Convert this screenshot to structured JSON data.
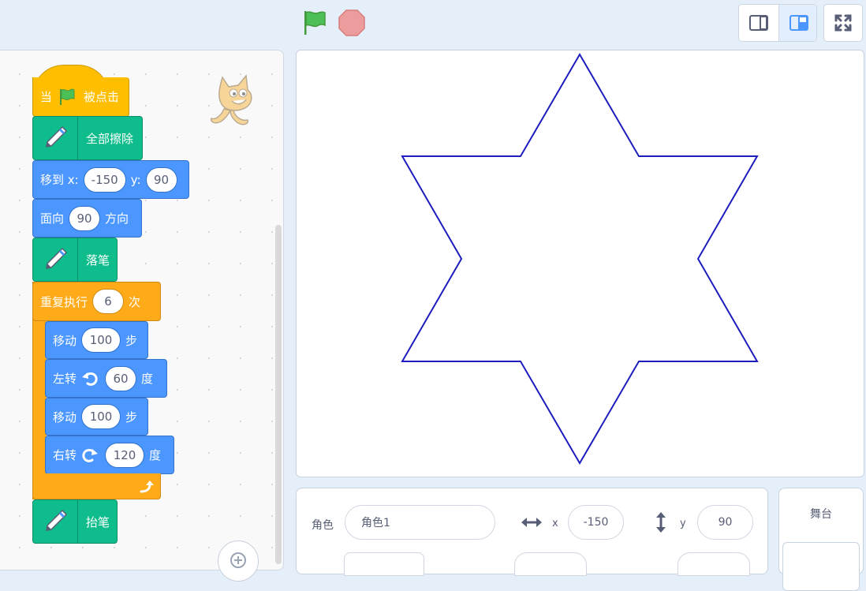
{
  "blocks": {
    "hat": {
      "when": "当",
      "clicked": "被点击"
    },
    "clear": {
      "label": "全部擦除"
    },
    "goto": {
      "label": "移到 x:",
      "x": "-150",
      "ylabel": "y:",
      "y": "90"
    },
    "point": {
      "label": "面向",
      "value": "90",
      "suffix": "方向"
    },
    "pen_down": {
      "label": "落笔"
    },
    "repeat": {
      "label": "重复执行",
      "times": "6",
      "suffix": "次"
    },
    "move1": {
      "label": "移动",
      "value": "100",
      "suffix": "步"
    },
    "turn_left": {
      "label": "左转",
      "value": "60",
      "suffix": "度"
    },
    "move2": {
      "label": "移动",
      "value": "100",
      "suffix": "步"
    },
    "turn_right": {
      "label": "右转",
      "value": "120",
      "suffix": "度"
    },
    "pen_up": {
      "label": "抬笔"
    }
  },
  "sprite_info": {
    "sprite_label": "角色",
    "sprite_name": "角色1",
    "x_label": "x",
    "x_value": "-150",
    "y_label": "y",
    "y_value": "90"
  },
  "stage_panel": {
    "label": "舞台"
  },
  "icons": [
    "green-flag-icon",
    "stop-icon",
    "small-stage-icon",
    "large-stage-icon",
    "fullscreen-icon",
    "pen-icon",
    "turn-left-icon",
    "turn-right-icon",
    "loop-arrow-icon",
    "horizontal-arrows-icon",
    "vertical-arrows-icon",
    "zoom-in-icon",
    "sprite-cat"
  ],
  "colors": {
    "motion": "#4c97ff",
    "control": "#ffab19",
    "pen": "#0fbd8c",
    "event": "#ffbf00",
    "pen_stroke": "#1d1dbd",
    "accent": "#4c97ff"
  }
}
